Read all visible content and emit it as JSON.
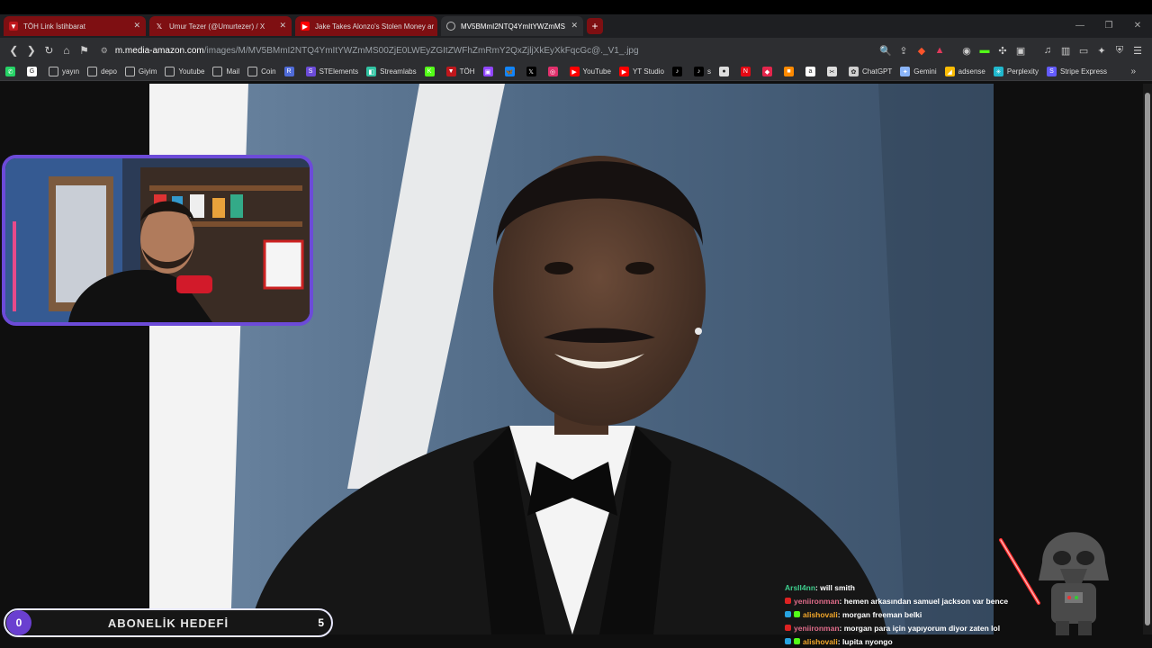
{
  "tabs": [
    {
      "title": "TÖH Link İstihbarat",
      "icon": "shield-icon",
      "style": "red"
    },
    {
      "title": "Umur Tezer (@Umurtezer) / X",
      "icon": "x-icon",
      "style": "red"
    },
    {
      "title": "Jake Takes Alonzo's Stolen Money ar",
      "icon": "youtube-icon",
      "style": "red"
    },
    {
      "title": "MV5BMmI2NTQ4YmItYWZmMS",
      "icon": "globe-icon",
      "style": "active"
    }
  ],
  "newtab_label": "+",
  "address": {
    "host": "m.media-amazon.com",
    "path": "/images/M/MV5BMmI2NTQ4YmItYWZmMS00ZjE0LWEyZGItZWFhZmRmY2QxZjljXkEyXkFqcGc@._V1_.jpg"
  },
  "bookmarks": [
    {
      "label": "",
      "icon": "whatsapp-icon",
      "color": "#25d366"
    },
    {
      "label": "",
      "icon": "google-icon",
      "color": "#ffffff"
    },
    {
      "label": "yayın",
      "icon": "folder-icon"
    },
    {
      "label": "depo",
      "icon": "folder-icon"
    },
    {
      "label": "Giyim",
      "icon": "folder-icon"
    },
    {
      "label": "Youtube",
      "icon": "folder-icon"
    },
    {
      "label": "Mail",
      "icon": "folder-icon"
    },
    {
      "label": "Coin",
      "icon": "folder-icon"
    },
    {
      "label": "",
      "icon": "r-icon",
      "color": "#4f6bd8"
    },
    {
      "label": "STElements",
      "icon": "se-icon",
      "color": "#6b4bd8"
    },
    {
      "label": "Streamlabs",
      "icon": "streamlabs-icon",
      "color": "#31c3a2"
    },
    {
      "label": "",
      "icon": "kick-icon",
      "color": "#53fc18"
    },
    {
      "label": "TÖH",
      "icon": "toh-icon",
      "color": "#c0171c"
    },
    {
      "label": "",
      "icon": "twitch-icon",
      "color": "#9146ff"
    },
    {
      "label": "",
      "icon": "bluesky-icon",
      "color": "#1185fe"
    },
    {
      "label": "",
      "icon": "x-icon",
      "color": "#000000"
    },
    {
      "label": "",
      "icon": "instagram-icon",
      "color": "#e1306c"
    },
    {
      "label": "YouTube",
      "icon": "youtube-icon",
      "color": "#ff0000"
    },
    {
      "label": "YT Studio",
      "icon": "yt-studio-icon",
      "color": "#ff0000"
    },
    {
      "label": "",
      "icon": "tiktok-icon",
      "color": "#000000"
    },
    {
      "label": "s",
      "icon": "tiktok-icon",
      "color": "#000000"
    },
    {
      "label": "",
      "icon": "circle-icon",
      "color": "#dddddd"
    },
    {
      "label": "",
      "icon": "netflix-icon",
      "color": "#e50914"
    },
    {
      "label": "",
      "icon": "red-app-icon",
      "color": "#e4264c"
    },
    {
      "label": "",
      "icon": "orange-app-icon",
      "color": "#ff8a00"
    },
    {
      "label": "",
      "icon": "amazon-icon",
      "color": "#ffffff"
    },
    {
      "label": "",
      "icon": "capcut-icon",
      "color": "#dddddd"
    },
    {
      "label": "ChatGPT",
      "icon": "chatgpt-icon",
      "color": "#cfcfcf"
    },
    {
      "label": "Gemini",
      "icon": "gemini-icon",
      "color": "#8ab4f8"
    },
    {
      "label": "adsense",
      "icon": "adsense-icon",
      "color": "#fbbc04"
    },
    {
      "label": "Perplexity",
      "icon": "perplexity-icon",
      "color": "#20b8cd"
    },
    {
      "label": "Stripe Express",
      "icon": "stripe-icon",
      "color": "#635bff"
    }
  ],
  "overlay": {
    "goal_title": "ABONELİK HEDEFİ",
    "goal_current": "0",
    "goal_target": "5"
  },
  "chat": [
    {
      "user": "Arsll4nn",
      "message": " : will smith",
      "color": "#3ecf8e"
    },
    {
      "user": "yeniironman",
      "message": " : hemen arkasından samuel jackson var bence",
      "color": "#e06c8a"
    },
    {
      "user": "alishovali",
      "message": " : morgan freeman belki",
      "color": "#f2a72a"
    },
    {
      "user": "yeniironman",
      "message": " : morgan para için yapıyorum diyor zaten lol",
      "color": "#e06c8a"
    },
    {
      "user": "alishovali",
      "message": " : lupita nyongo",
      "color": "#f2a72a"
    }
  ]
}
